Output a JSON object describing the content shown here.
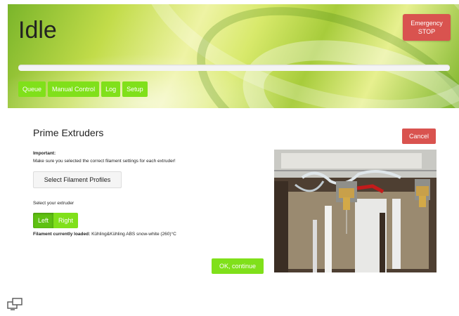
{
  "header": {
    "status": "Idle",
    "emergency_line1": "Emergency",
    "emergency_line2": "STOP",
    "progress": 0,
    "tabs": [
      "Queue",
      "Manual Control",
      "Log",
      "Setup"
    ]
  },
  "dialog": {
    "title": "Prime Extruders",
    "cancel_label": "Cancel",
    "important_label": "Important:",
    "important_text": "Make sure you selected the correct filament settings for each extruder!",
    "select_profiles_label": "Select Filament Profiles",
    "select_extruder_label": "Select your extruder",
    "extruder_options": [
      "Left",
      "Right"
    ],
    "selected_extruder": "Left",
    "filament_label": "Filament currently loaded:",
    "filament_value": "Kühling&Kühling ABS snow-white (260)°C",
    "continue_label": "OK, continue"
  },
  "photo": {
    "description_icon": "printer-extruders-photo"
  },
  "footer": {
    "icon": "display-icon"
  },
  "colors": {
    "accent_green": "#80e01a",
    "danger_red": "#d9534f"
  }
}
